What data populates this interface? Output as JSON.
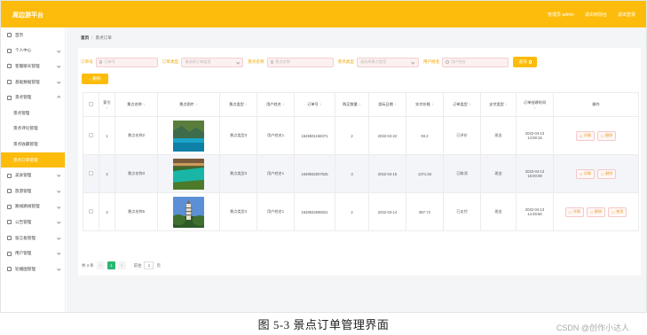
{
  "header": {
    "brand": "周边游平台",
    "links": [
      "管理员 admin",
      "退出到前台",
      "退出登录"
    ]
  },
  "sidebar": {
    "items": [
      {
        "label": "首页",
        "icon": "home-icon"
      },
      {
        "label": "个人中心",
        "icon": "user-icon"
      },
      {
        "label": "客服聊天管理",
        "icon": "chat-icon"
      },
      {
        "label": "基础数据管理",
        "icon": "data-icon"
      },
      {
        "label": "景点管理",
        "icon": "scenic-icon"
      }
    ],
    "subitems": [
      "景点管理",
      "景点评论管理",
      "景点收藏管理",
      "景点订单管理"
    ],
    "items2": [
      {
        "label": "美食管理",
        "icon": "food-icon"
      },
      {
        "label": "旅游管理",
        "icon": "travel-icon"
      },
      {
        "label": "路线路线管理",
        "icon": "route-icon"
      },
      {
        "label": "公告管理",
        "icon": "notice-icon"
      },
      {
        "label": "留言板管理",
        "icon": "message-icon"
      },
      {
        "label": "用户管理",
        "icon": "users-icon"
      },
      {
        "label": "轮播图管理",
        "icon": "carousel-icon"
      }
    ]
  },
  "breadcrumb": {
    "home": "首页",
    "current": "景点订单"
  },
  "filters": {
    "order_no_label": "订单号",
    "order_no_ph": "订单号",
    "order_type_label": "订单类型",
    "order_type_ph": "请选择订单类型",
    "scenic_name_label": "景点名称",
    "scenic_name_ph": "景点名称",
    "scenic_type_label": "景点类型",
    "scenic_type_ph": "请选择景点类型",
    "username_label": "用户姓名",
    "username_ph": "用户姓名",
    "search_btn": "查询"
  },
  "toolbar": {
    "delete_btn": "删除"
  },
  "table": {
    "headers": [
      "",
      "索引",
      "景点名称",
      "景点图片",
      "景点类型",
      "用户姓名",
      "订单号",
      "购买数量",
      "游玩日期",
      "实付价格",
      "订单类型",
      "支付类型",
      "订单创建时间",
      "操作"
    ],
    "rows": [
      {
        "index": "1",
        "name": "景点名称2",
        "type": "景点类型3",
        "user": "用户姓名1",
        "order": "1649831156371",
        "qty": "2",
        "date": "2022-04-22",
        "price": "93.2",
        "otype": "已评价",
        "pay": "现金",
        "created": "2022-04-13 14:59:16",
        "ops": [
          "详情",
          "删除"
        ],
        "thumb": "lake"
      },
      {
        "index": "2",
        "name": "景点名称3",
        "type": "景点类型3",
        "user": "用户姓名1",
        "order": "1649832607625",
        "qty": "3",
        "date": "2022-04-15",
        "price": "1371.93",
        "otype": "已取消",
        "pay": "现金",
        "created": "2022-04-13 15:00:08",
        "ops": [
          "详情",
          "删除"
        ],
        "thumb": "river"
      },
      {
        "index": "3",
        "name": "景点名称5",
        "type": "景点类型4",
        "user": "用户姓名1",
        "order": "1649832596021",
        "qty": "2",
        "date": "2022-04-14",
        "price": "987.72",
        "otype": "已支付",
        "pay": "现金",
        "created": "2022-04-13 14:49:56",
        "ops": [
          "详情",
          "删除",
          "使用"
        ],
        "thumb": "pagoda"
      }
    ]
  },
  "pager": {
    "total": "共 3 条",
    "prev": "<",
    "page": "1",
    "next": ">",
    "goto": "前往",
    "goto_value": "1",
    "unit": "页"
  },
  "caption": "图 5-3  景点订单管理界面",
  "watermark": "CSDN @创作小达人"
}
